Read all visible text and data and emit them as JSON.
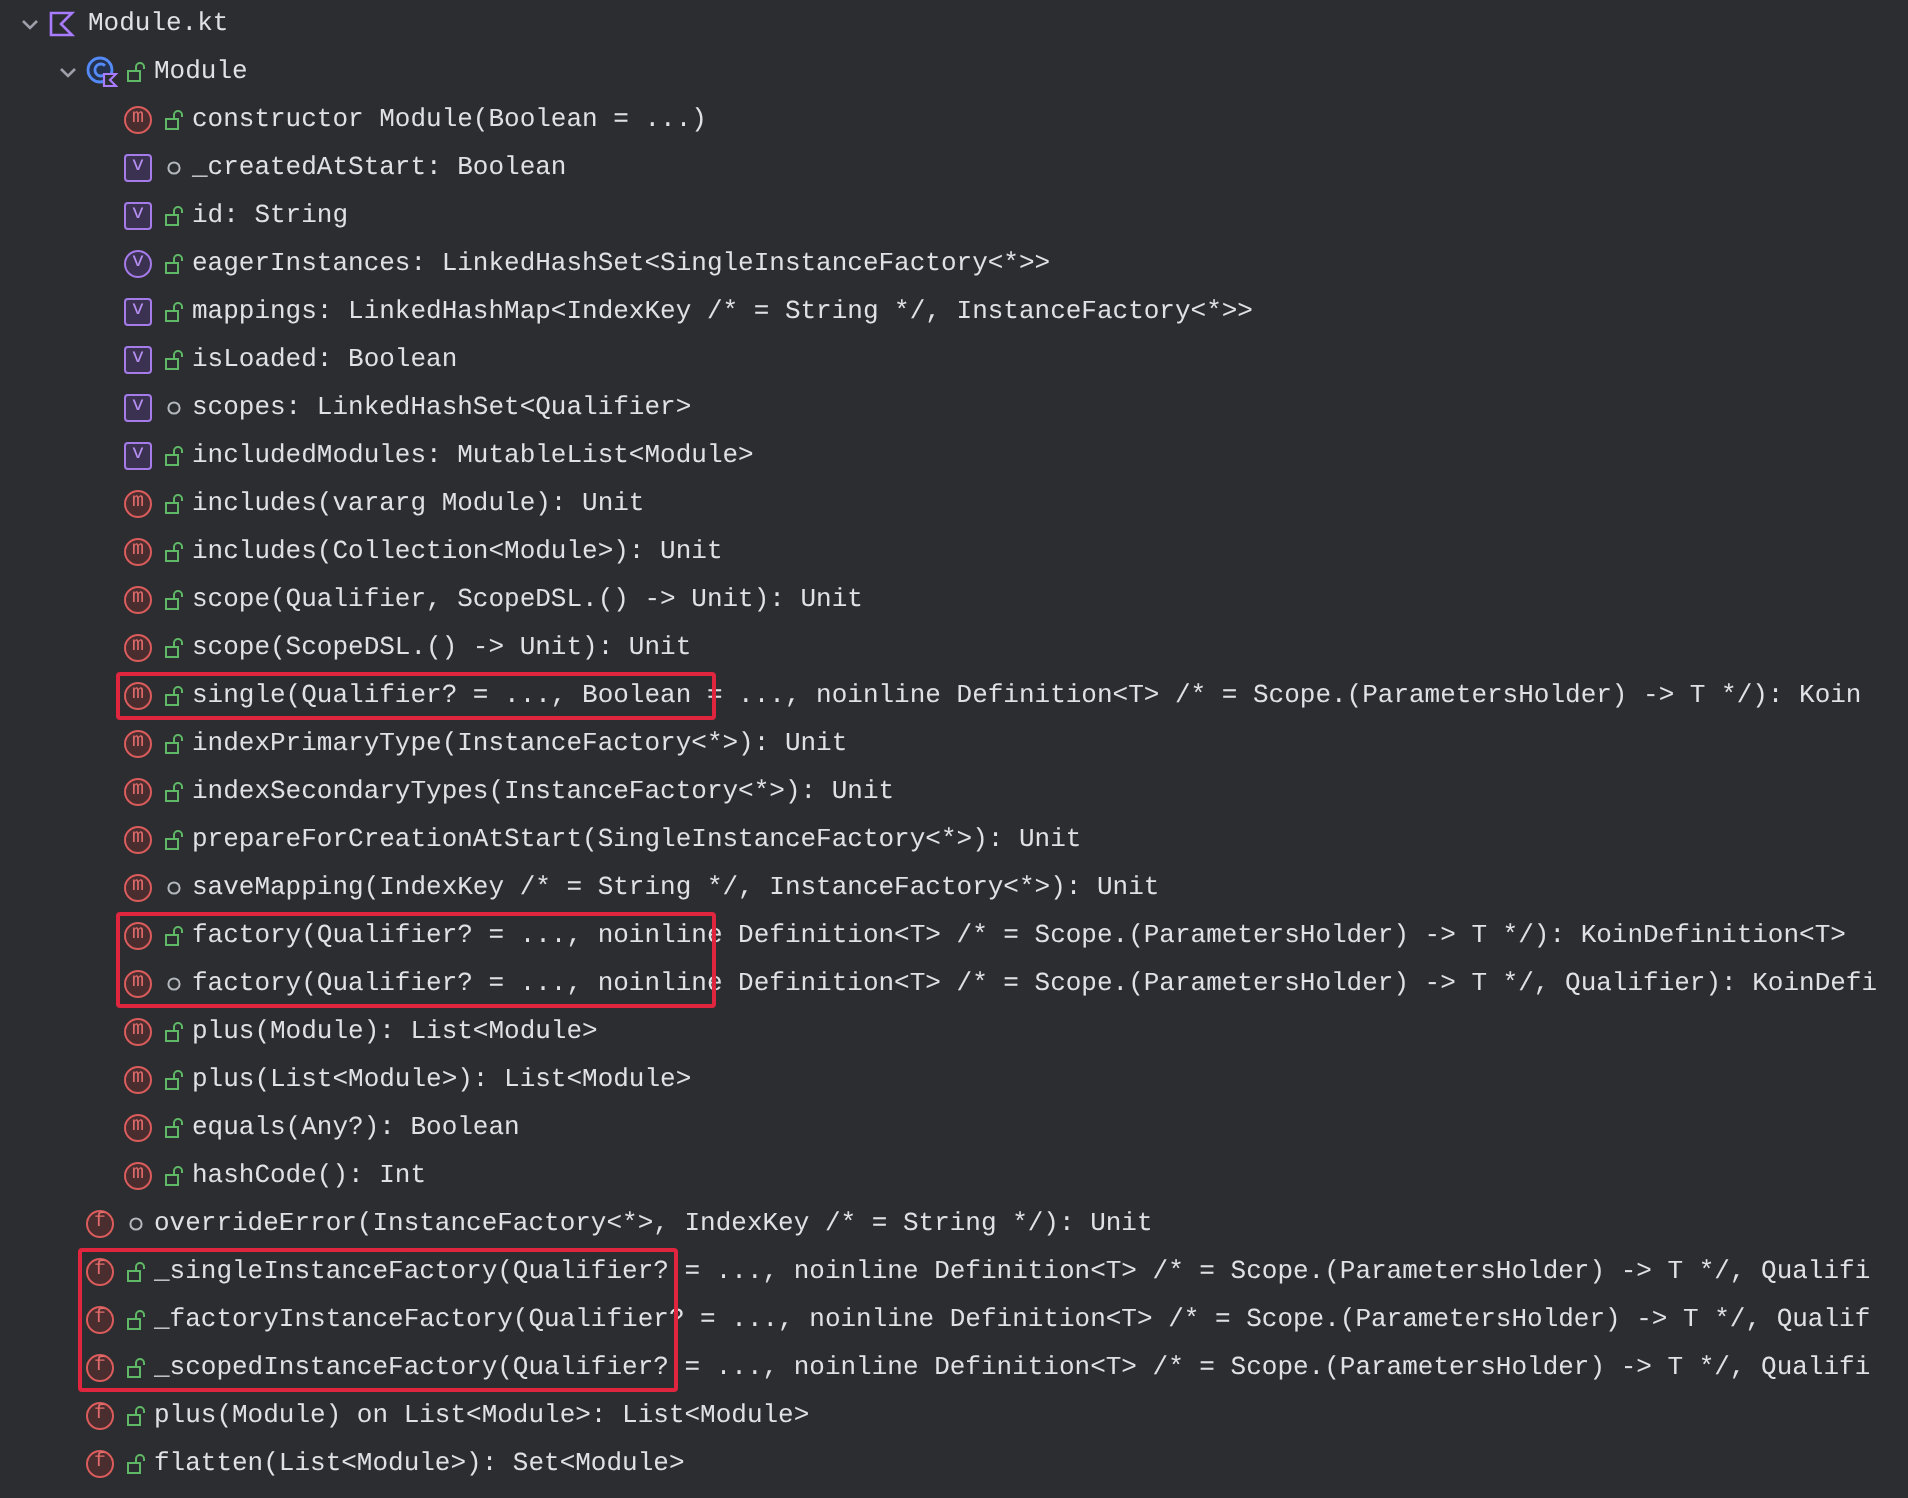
{
  "tree": [
    {
      "kind": "file",
      "text": "Module.kt",
      "expanded": true,
      "children": [
        {
          "kind": "class",
          "public": true,
          "text": "Module",
          "expanded": true,
          "children": [
            {
              "kind": "method",
              "badge": "m",
              "public": true,
              "text": "constructor Module(Boolean = ...)"
            },
            {
              "kind": "val",
              "badge": "v",
              "public": false,
              "text": "_createdAtStart: Boolean"
            },
            {
              "kind": "val",
              "badge": "v",
              "public": true,
              "text": "id: String"
            },
            {
              "kind": "var",
              "badge": "v",
              "public": true,
              "text": "eagerInstances: LinkedHashSet<SingleInstanceFactory<*>>"
            },
            {
              "kind": "val",
              "badge": "v",
              "public": true,
              "text": "mappings: LinkedHashMap<IndexKey /* = String */, InstanceFactory<*>>"
            },
            {
              "kind": "val",
              "badge": "v",
              "public": true,
              "text": "isLoaded: Boolean"
            },
            {
              "kind": "val",
              "badge": "v",
              "public": false,
              "text": "scopes: LinkedHashSet<Qualifier>"
            },
            {
              "kind": "val",
              "badge": "v",
              "public": true,
              "text": "includedModules: MutableList<Module>"
            },
            {
              "kind": "method",
              "badge": "m",
              "public": true,
              "text": "includes(vararg Module): Unit"
            },
            {
              "kind": "method",
              "badge": "m",
              "public": true,
              "text": "includes(Collection<Module>): Unit"
            },
            {
              "kind": "method",
              "badge": "m",
              "public": true,
              "text": "scope(Qualifier, ScopeDSL.() -> Unit): Unit"
            },
            {
              "kind": "method",
              "badge": "m",
              "public": true,
              "text": "scope(ScopeDSL.() -> Unit): Unit"
            },
            {
              "kind": "method",
              "badge": "m",
              "public": true,
              "text": "single(Qualifier? = ..., Boolean = ..., noinline Definition<T> /* = Scope.(ParametersHolder) -> T */): Koin",
              "boxed": true
            },
            {
              "kind": "method",
              "badge": "m",
              "public": true,
              "text": "indexPrimaryType(InstanceFactory<*>): Unit"
            },
            {
              "kind": "method",
              "badge": "m",
              "public": true,
              "text": "indexSecondaryTypes(InstanceFactory<*>): Unit"
            },
            {
              "kind": "method",
              "badge": "m",
              "public": true,
              "text": "prepareForCreationAtStart(SingleInstanceFactory<*>): Unit"
            },
            {
              "kind": "method",
              "badge": "m",
              "public": false,
              "text": "saveMapping(IndexKey /* = String */, InstanceFactory<*>): Unit"
            },
            {
              "kind": "method",
              "badge": "m",
              "public": true,
              "text": "factory(Qualifier? = ..., noinline Definition<T> /* = Scope.(ParametersHolder) -> T */): KoinDefinition<T>",
              "boxed": true
            },
            {
              "kind": "method",
              "badge": "m",
              "public": false,
              "text": "factory(Qualifier? = ..., noinline Definition<T> /* = Scope.(ParametersHolder) -> T */, Qualifier): KoinDefi",
              "boxed": true
            },
            {
              "kind": "method",
              "badge": "m",
              "public": true,
              "text": "plus(Module): List<Module>"
            },
            {
              "kind": "method",
              "badge": "m",
              "public": true,
              "text": "plus(List<Module>): List<Module>"
            },
            {
              "kind": "method",
              "badge": "m",
              "public": true,
              "text": "equals(Any?): Boolean"
            },
            {
              "kind": "method",
              "badge": "m",
              "public": true,
              "text": "hashCode(): Int"
            }
          ]
        },
        {
          "kind": "function",
          "badge": "f",
          "public": false,
          "text": "overrideError(InstanceFactory<*>, IndexKey /* = String */): Unit"
        },
        {
          "kind": "function",
          "badge": "f",
          "public": true,
          "text": "_singleInstanceFactory(Qualifier? = ..., noinline Definition<T> /* = Scope.(ParametersHolder) -> T */, Qualifi",
          "boxed": true
        },
        {
          "kind": "function",
          "badge": "f",
          "public": true,
          "text": "_factoryInstanceFactory(Qualifier? = ..., noinline Definition<T> /* = Scope.(ParametersHolder) -> T */, Qualif",
          "boxed": true
        },
        {
          "kind": "function",
          "badge": "f",
          "public": true,
          "text": "_scopedInstanceFactory(Qualifier? = ..., noinline Definition<T> /* = Scope.(ParametersHolder) -> T */, Qualifi",
          "boxed": true
        },
        {
          "kind": "function",
          "badge": "f",
          "public": true,
          "text": "plus(Module) on List<Module>: List<Module>"
        },
        {
          "kind": "function",
          "badge": "f",
          "public": true,
          "text": "flatten(List<Module>): Set<Module>"
        }
      ]
    }
  ]
}
